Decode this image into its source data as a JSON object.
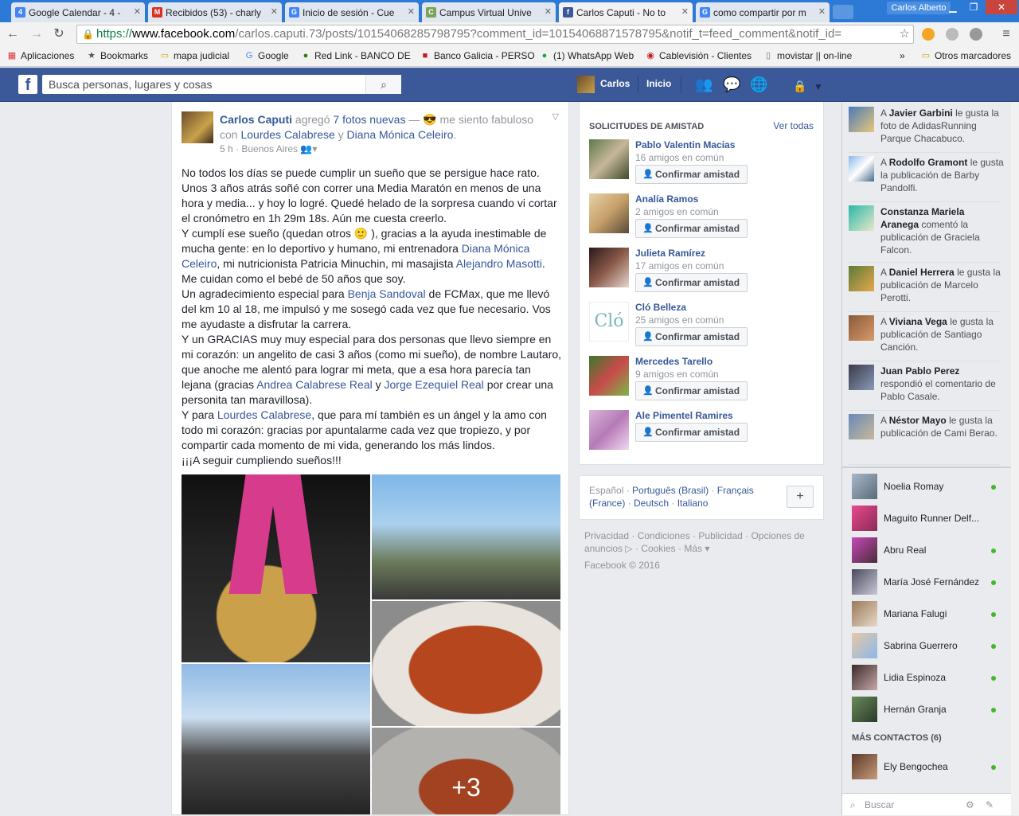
{
  "browser": {
    "tabs": [
      {
        "label": "Google Calendar - 4 -",
        "icon": "calendar-icon",
        "color": "#4285f4",
        "glyph": "4"
      },
      {
        "label": "Recibidos (53) - charly",
        "icon": "gmail-icon",
        "color": "#d93025",
        "glyph": "M"
      },
      {
        "label": "Inicio de sesión - Cue",
        "icon": "google-icon",
        "color": "#4285f4",
        "glyph": "G"
      },
      {
        "label": "Campus Virtual Unive",
        "icon": "campus-icon",
        "color": "#7aa35b",
        "glyph": "C"
      },
      {
        "label": "Carlos Caputi - No to",
        "icon": "facebook-icon",
        "color": "#3b5998",
        "glyph": "f"
      },
      {
        "label": "como compartir por m",
        "icon": "google-icon",
        "color": "#4285f4",
        "glyph": "G"
      }
    ],
    "profile_name": "Carlos Alberto",
    "url": {
      "scheme": "https",
      "host": "www.facebook.com",
      "path": "/carlos.caputi.73/posts/10154068285798795?comment_id=10154068871578795&notif_t=feed_comment&notif_id="
    },
    "bookmarks": [
      {
        "label": "Aplicaciones",
        "icon": "apps-icon"
      },
      {
        "label": "Bookmarks",
        "icon": "star-icon"
      },
      {
        "label": "mapa judicial",
        "icon": "folder-icon"
      },
      {
        "label": "Google",
        "icon": "google-icon"
      },
      {
        "label": "Red Link - BANCO DE",
        "icon": "link-icon"
      },
      {
        "label": "Banco Galicia - PERSO",
        "icon": "bank-icon"
      },
      {
        "label": "(1) WhatsApp Web",
        "icon": "whatsapp-icon"
      },
      {
        "label": "Cablevisión - Clientes",
        "icon": "cable-icon"
      },
      {
        "label": "movistar || on-line",
        "icon": "page-icon"
      }
    ],
    "bookmarks_more": "»",
    "other_bookmarks": "Otros marcadores"
  },
  "facebook": {
    "brand_color": "#3b5998",
    "search_placeholder": "Busca personas, lugares y cosas",
    "nav_user": "Carlos",
    "nav_home": "Inicio"
  },
  "post": {
    "author": "Carlos Caputi",
    "action_1": "agregó",
    "photos_link": "7 fotos nuevas",
    "action_2": "— 😎 me siento fabuloso con",
    "tag_1": "Lourdes Calabrese",
    "conj": "y",
    "tag_2": "Diana Mónica Celeiro",
    "end": ".",
    "time": "5 h",
    "location": "Buenos Aires",
    "p1": "No todos los días se puede cumplir un sueño que se persigue hace rato. Unos 3 años atrás soñé con correr una Media Maratón en menos de una hora y media... y hoy lo logré. Quedé helado de la sorpresa cuando vi cortar el cronómetro en 1h 29m 18s. Aún me cuesta creerlo.",
    "p2a": "Y cumplí ese sueño (quedan otros 🙂 ), gracias a la ayuda inestimable de mucha gente: en lo deportivo y humano, mi entrenadora",
    "p2_link1": "Diana Mónica Celeiro",
    "p2b": ", mi nutricionista Patricia Minuchin, mi masajista",
    "p2_link2": "Alejandro Masotti",
    "p2c": ". Me cuidan como el bebé de 50 años que soy.",
    "p3a": "Un agradecimiento especial para",
    "p3_link": "Benja Sandoval",
    "p3b": "de FCMax, que me llevó del km 10 al 18, me impulsó y me sosegó cada vez que fue necesario. Vos me ayudaste a disfrutar la carrera.",
    "p4a": "Y un GRACIAS muy muy especial para dos personas que llevo siempre en mi corazón: un angelito de casi 3 años (como mi sueño), de nombre Lautaro, que anoche me alentó para lograr mi meta, que a esa hora parecía tan lejana (gracias",
    "p4_link1": "Andrea Calabrese Real",
    "p4_and": "y",
    "p4_link2": "Jorge Ezequiel Real",
    "p4b": "por crear una personita tan maravillosa).",
    "p5a": "Y para",
    "p5_link": "Lourdes Calabrese",
    "p5b": ", que para mí también es un ángel y la amo con todo mi corazón: gracias por apuntalarme cada vez que tropiezo, y por compartir cada momento de mi vida, generando los más lindos.",
    "p6": "¡¡¡A seguir cumpliendo sueños!!!",
    "more_photos": "+3"
  },
  "friend_requests": {
    "title": "SOLICITUDES DE AMISTAD",
    "see_all": "Ver todas",
    "confirm_label": "Confirmar amistad",
    "items": [
      {
        "name": "Pablo Valentin Macias",
        "mutual": "16 amigos en común"
      },
      {
        "name": "Analía Ramos",
        "mutual": "2 amigos en común"
      },
      {
        "name": "Julieta Ramírez",
        "mutual": "17 amigos en común"
      },
      {
        "name": "Cló Belleza",
        "mutual": "25 amigos en común"
      },
      {
        "name": "Mercedes Tarello",
        "mutual": "9 amigos en común"
      },
      {
        "name": "Ale Pimentel Ramires",
        "mutual": ""
      }
    ]
  },
  "languages": {
    "current": "Español",
    "others": [
      "Português (Brasil)",
      "Français (France)",
      "Deutsch",
      "Italiano"
    ],
    "plus": "+"
  },
  "footer": {
    "links": [
      "Privacidad",
      "Condiciones",
      "Publicidad",
      "Opciones de anuncios",
      "Cookies",
      "Más"
    ],
    "copyright": "Facebook © 2016"
  },
  "ticker": [
    {
      "pre": "A",
      "name": "Javier Garbini",
      "text": "le gusta la foto de AdidasRunning Parque Chacabuco."
    },
    {
      "pre": "A",
      "name": "Rodolfo Gramont",
      "text": "le gusta la publicación de Barby Pandolfi."
    },
    {
      "pre": "",
      "name": "Constanza Mariela Aranega",
      "text": "comentó la publicación de Graciela Falcon."
    },
    {
      "pre": "A",
      "name": "Daniel Herrera",
      "text": "le gusta la publicación de Marcelo Perotti."
    },
    {
      "pre": "A",
      "name": "Viviana Vega",
      "text": "le gusta la publicación de Santiago Canción."
    },
    {
      "pre": "",
      "name": "Juan Pablo Perez",
      "text": "respondió el comentario de Pablo Casale."
    },
    {
      "pre": "A",
      "name": "Néstor Mayo",
      "text": "le gusta la publicación de Cami Berao."
    }
  ],
  "contacts": [
    {
      "name": "Noelia Romay",
      "online": true
    },
    {
      "name": "Maguito Runner Delf...",
      "online": false
    },
    {
      "name": "Abru Real",
      "online": true
    },
    {
      "name": "María José Fernández",
      "online": true
    },
    {
      "name": "Mariana Falugi",
      "online": true
    },
    {
      "name": "Sabrina Guerrero",
      "online": true
    },
    {
      "name": "Lidia Espinoza",
      "online": true
    },
    {
      "name": "Hernán Granja",
      "online": true
    }
  ],
  "more_contacts_title": "MÁS CONTACTOS (6)",
  "more_contacts": [
    {
      "name": "Ely Bengochea",
      "online": true
    }
  ],
  "chat_search_placeholder": "Buscar"
}
